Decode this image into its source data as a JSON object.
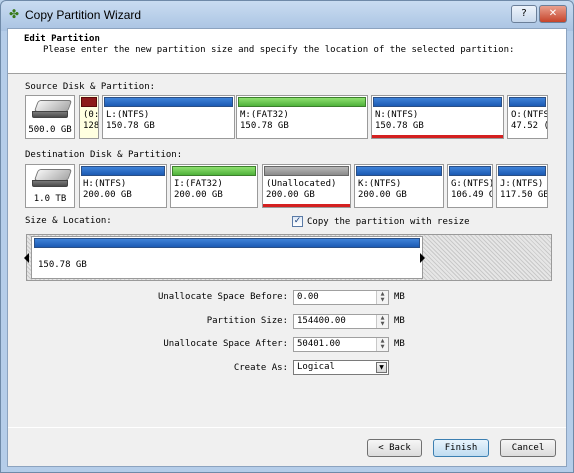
{
  "window": {
    "title": "Copy Partition Wizard",
    "help": "?",
    "close": "✕"
  },
  "header": {
    "title": "Edit Partition",
    "subtitle": "Please enter the new partition size and specify the location of the selected partition:"
  },
  "source": {
    "label": "Source Disk & Partition:",
    "disk_size": "500.0 GB",
    "partitions": [
      {
        "line1": "(0:",
        "line2": "128",
        "fs": "maroon",
        "selected": false
      },
      {
        "line1": "L:(NTFS)",
        "line2": "150.78 GB",
        "fs": "ntfs",
        "selected": false
      },
      {
        "line1": "M:(FAT32)",
        "line2": "150.78 GB",
        "fs": "fat32",
        "selected": false
      },
      {
        "line1": "N:(NTFS)",
        "line2": "150.78 GB",
        "fs": "ntfs",
        "selected": true
      },
      {
        "line1": "O:(NTFS",
        "line2": "47.52 (",
        "fs": "ntfs",
        "selected": false
      }
    ]
  },
  "destination": {
    "label": "Destination Disk & Partition:",
    "disk_size": "1.0 TB",
    "partitions": [
      {
        "line1": "H:(NTFS)",
        "line2": "200.00 GB",
        "fs": "ntfs",
        "selected": false
      },
      {
        "line1": "I:(FAT32)",
        "line2": "200.00 GB",
        "fs": "fat32",
        "selected": false
      },
      {
        "line1": "(Unallocated)",
        "line2": "200.00 GB",
        "fs": "unalloc",
        "selected": true
      },
      {
        "line1": "K:(NTFS)",
        "line2": "200.00 GB",
        "fs": "ntfs",
        "selected": false
      },
      {
        "line1": "G:(NTFS)",
        "line2": "106.49 G",
        "fs": "ntfs",
        "selected": false
      },
      {
        "line1": "J:(NTFS)",
        "line2": "117.50 GB",
        "fs": "ntfs",
        "selected": false
      }
    ]
  },
  "size_location": {
    "label": "Size & Location:",
    "copy_with_resize_label": "Copy the partition with resize",
    "copy_with_resize_checked": "✓",
    "partition_label": "150.78 GB"
  },
  "fields": {
    "before_label": "Unallocate Space Before:",
    "before_value": "0.00",
    "size_label": "Partition Size:",
    "size_value": "154400.00",
    "after_label": "Unallocate Space After:",
    "after_value": "50401.00",
    "unit": "MB",
    "create_as_label": "Create As:",
    "create_as_value": "Logical"
  },
  "buttons": {
    "back": "< Back",
    "finish": "Finish",
    "cancel": "Cancel"
  }
}
